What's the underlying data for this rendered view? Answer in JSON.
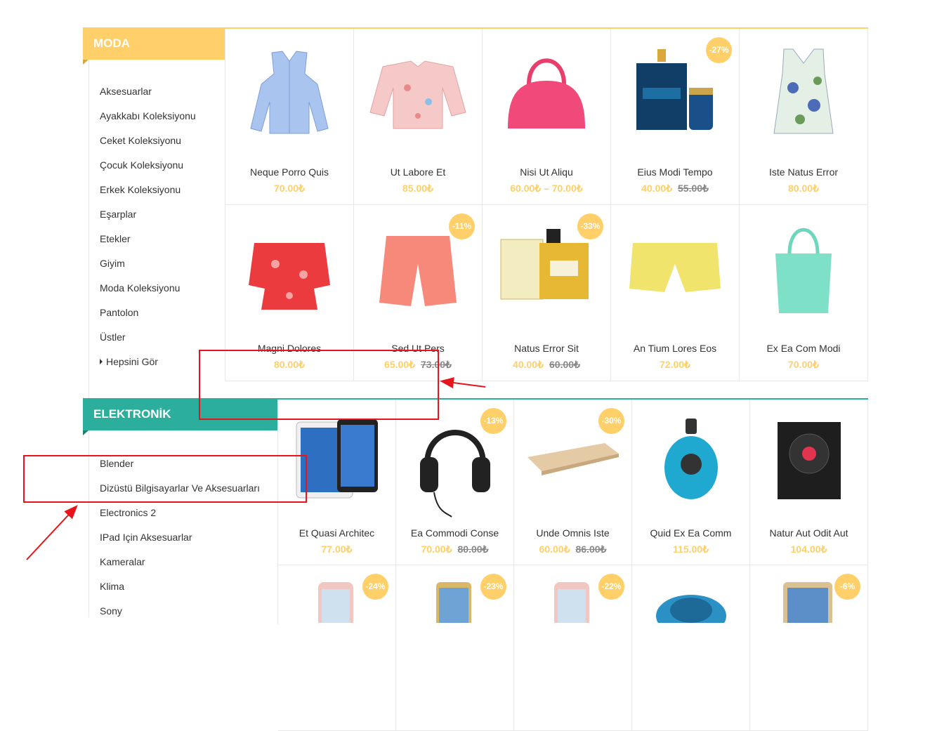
{
  "moda": {
    "title": "MODA",
    "categories": [
      "Aksesuarlar",
      "Ayakkabı Koleksiyonu",
      "Ceket Koleksiyonu",
      "Çocuk Koleksiyonu",
      "Erkek Koleksiyonu",
      "Eşarplar",
      "Etekler",
      "Giyim",
      "Moda Koleksiyonu",
      "Pantolon",
      "Üstler"
    ],
    "see_all": "Hepsini Gör",
    "products": [
      {
        "name": "Neque Porro Quis",
        "price": "70.00₺",
        "old": "",
        "badge": "",
        "img": "blouse-blue"
      },
      {
        "name": "Ut Labore Et",
        "price": "85.00₺",
        "old": "",
        "badge": "",
        "img": "blouse-floral"
      },
      {
        "name": "Nisi Ut Aliqu",
        "price": "60.00₺ – 70.00₺",
        "old": "",
        "badge": "",
        "img": "handbag-pink"
      },
      {
        "name": "Eius Modi Tempo",
        "price": "40.00₺",
        "old": "55.00₺",
        "badge": "-27%",
        "img": "perfume-versace"
      },
      {
        "name": "Iste Natus Error",
        "price": "80.00₺",
        "old": "",
        "badge": "",
        "img": "top-floral"
      },
      {
        "name": "Magni Dolores",
        "price": "80.00₺",
        "old": "",
        "badge": "",
        "img": "top-red"
      },
      {
        "name": "Sed Ut Pers",
        "price": "65.00₺",
        "old": "73.00₺",
        "badge": "-11%",
        "img": "shorts-coral"
      },
      {
        "name": "Natus Error Sit",
        "price": "40.00₺",
        "old": "60.00₺",
        "badge": "-33%",
        "img": "perfume-gold"
      },
      {
        "name": "An Tium Lores Eos",
        "price": "72.00₺",
        "old": "",
        "badge": "",
        "img": "shorts-yellow"
      },
      {
        "name": "Ex Ea Com Modi",
        "price": "70.00₺",
        "old": "",
        "badge": "",
        "img": "tote-mint"
      }
    ]
  },
  "elektronik": {
    "title": "ELEKTRONİK",
    "categories": [
      "Blender",
      "Dizüstü Bilgisayarlar Ve Aksesuarları",
      "Electronics 2",
      "IPad Için Aksesuarlar",
      "Kameralar",
      "Klima",
      "Sony"
    ],
    "products": [
      {
        "name": "Et Quasi Architec",
        "price": "77.00₺",
        "old": "",
        "badge": "",
        "img": "ipad"
      },
      {
        "name": "Ea Commodi Conse",
        "price": "70.00₺",
        "old": "80.00₺",
        "badge": "-13%",
        "img": "headphones"
      },
      {
        "name": "Unde Omnis Iste",
        "price": "60.00₺",
        "old": "86.00₺",
        "badge": "-30%",
        "img": "laptop-gold"
      },
      {
        "name": "Quid Ex Ea Comm",
        "price": "115.00₺",
        "old": "",
        "badge": "",
        "img": "vacuum-blue"
      },
      {
        "name": "Natur Aut Odit Aut",
        "price": "104.00₺",
        "old": "",
        "badge": "",
        "img": "speaker"
      },
      {
        "name": "",
        "price": "",
        "old": "",
        "badge": "-24%",
        "img": "iphone-rose"
      },
      {
        "name": "",
        "price": "",
        "old": "",
        "badge": "-23%",
        "img": "galaxy-note"
      },
      {
        "name": "",
        "price": "",
        "old": "",
        "badge": "-22%",
        "img": "iphone-rose-2"
      },
      {
        "name": "",
        "price": "",
        "old": "",
        "badge": "",
        "img": "vacuum-robot"
      },
      {
        "name": "",
        "price": "",
        "old": "",
        "badge": "-6%",
        "img": "ipad-mini"
      }
    ]
  },
  "colors": {
    "moda_accent": "#ffcf6a",
    "elektronik_accent": "#2cae9d",
    "annotation": "#e8141b"
  }
}
